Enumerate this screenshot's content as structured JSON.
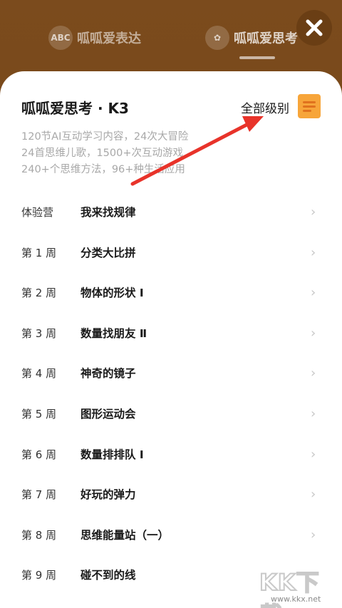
{
  "header": {
    "tabs": [
      {
        "label": "呱呱爱表达",
        "icon": "abc-icon",
        "icon_text": "ABC"
      },
      {
        "label": "呱呱爱思考",
        "icon": "puzzle-icon",
        "icon_text": "✿"
      }
    ],
    "close_icon": "close-icon"
  },
  "course": {
    "title": "呱呱爱思考 · K3",
    "level_label": "全部级别",
    "description": [
      "120节AI互动学习内容，24次大冒险",
      "24首思维儿歌，1500+次互动游戏",
      "240+个思维方法，96+种生活应用"
    ]
  },
  "weeks": [
    {
      "label": "体验营",
      "name": "我来找规律"
    },
    {
      "label": "第 1 周",
      "name": "分类大比拼"
    },
    {
      "label": "第 2 周",
      "name": "物体的形状 Ⅰ"
    },
    {
      "label": "第 3 周",
      "name": "数量找朋友 Ⅱ"
    },
    {
      "label": "第 4 周",
      "name": "神奇的镜子"
    },
    {
      "label": "第 5 周",
      "name": "图形运动会"
    },
    {
      "label": "第 6 周",
      "name": "数量排排队 Ⅰ"
    },
    {
      "label": "第 7 周",
      "name": "好玩的弹力"
    },
    {
      "label": "第 8 周",
      "name": "思维能量站（一）"
    },
    {
      "label": "第 9 周",
      "name": "碰不到的线"
    }
  ],
  "watermark": {
    "text": "KK下载",
    "url": "www.kkx.net"
  },
  "colors": {
    "brand_brown": "#7a4a1c",
    "accent_orange": "#f7a53a",
    "arrow_red": "#e8332a"
  }
}
